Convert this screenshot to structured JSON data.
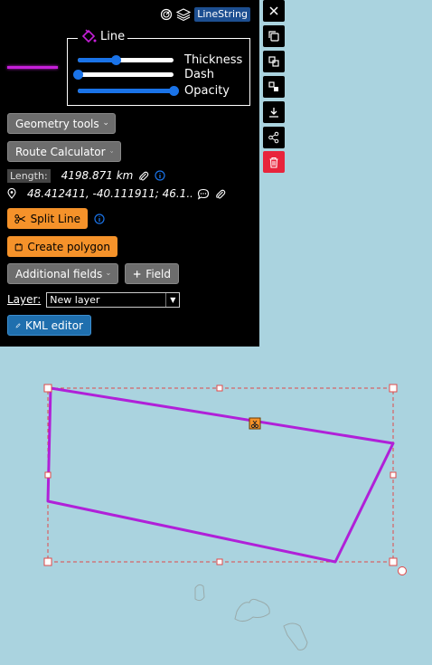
{
  "header": {
    "geometry_type": "LineString"
  },
  "style": {
    "legend": "Line",
    "color": "#c61fd9",
    "thickness_label": "Thickness",
    "thickness_value": 0.4,
    "dash_label": "Dash",
    "dash_value": 0.0,
    "opacity_label": "Opacity",
    "opacity_value": 1.0
  },
  "buttons": {
    "geometry_tools": "Geometry tools",
    "route_calculator": "Route Calculator",
    "split_line": "Split Line",
    "create_polygon": "Create polygon",
    "additional_fields": "Additional fields",
    "field": "Field",
    "kml_editor": "KML editor"
  },
  "measurement": {
    "length_label": "Length:",
    "length_value": "4198.871 km",
    "coordinates": "48.412411, -40.111911; 46.1..."
  },
  "layer": {
    "label": "Layer:",
    "selected": "New layer"
  },
  "toolbar": {
    "icons": [
      "close-icon",
      "copy-icon",
      "duplicate-icon",
      "transform-icon",
      "download-icon",
      "share-icon",
      "trash-icon"
    ]
  },
  "colors": {
    "map_water": "#aad3df",
    "panel_bg": "#000000",
    "accent_blue": "#1a73e8",
    "action_orange": "#f5922a",
    "danger_red": "#e8243c"
  }
}
